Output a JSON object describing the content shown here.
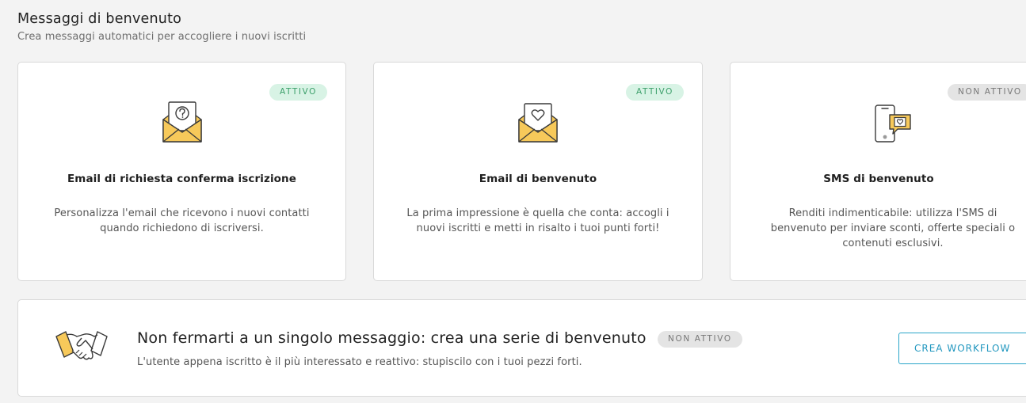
{
  "header": {
    "title": "Messaggi di benvenuto",
    "subtitle": "Crea messaggi automatici per accogliere i nuovi iscritti"
  },
  "cards": [
    {
      "status": "ATTIVO",
      "icon": "envelope-question-icon",
      "title": "Email di richiesta conferma iscrizione",
      "description": "Personalizza l'email che ricevono i nuovi contatti quando richiedono di iscriversi."
    },
    {
      "status": "ATTIVO",
      "icon": "envelope-heart-icon",
      "title": "Email di benvenuto",
      "description": "La prima impressione è quella che conta: accogli i nuovi iscritti e metti in risalto i tuoi punti forti!"
    },
    {
      "status": "NON ATTIVO",
      "icon": "phone-message-icon",
      "title": "SMS di benvenuto",
      "description": "Renditi indimenticabile: utilizza l'SMS di benvenuto per inviare sconti, offerte speciali o contenuti esclusivi."
    }
  ],
  "banner": {
    "icon": "handshake-icon",
    "title": "Non fermarti a un singolo messaggio: crea una serie di benvenuto",
    "status": "NON ATTIVO",
    "description": "L'utente appena iscritto è il più interessato e reattivo: stupiscilo con i tuoi pezzi forti.",
    "button_label": "CREA WORKFLOW"
  },
  "colors": {
    "envelope_yellow": "#f7c95a",
    "active_badge_bg": "#d8f3e5",
    "active_badge_text": "#3c9f6a",
    "inactive_badge_bg": "#e4e4e4",
    "button_accent": "#2aa5c9"
  }
}
